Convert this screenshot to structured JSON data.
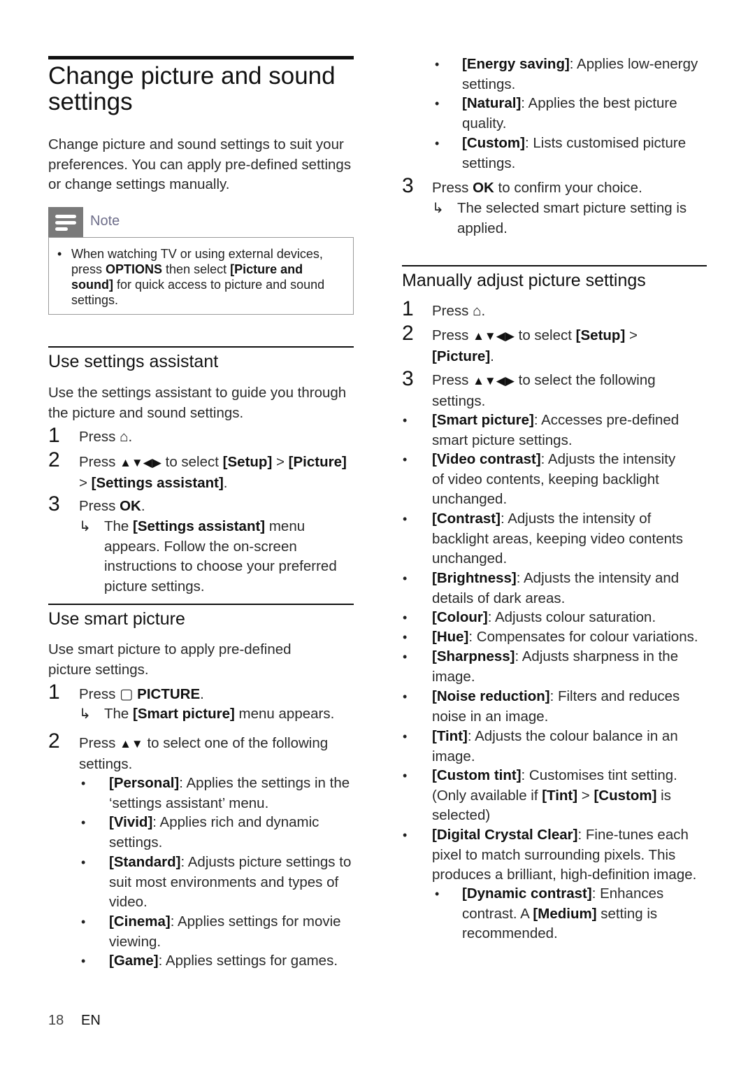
{
  "page": {
    "title": "Change picture and sound settings",
    "intro": "Change picture and sound settings to suit your preferences. You can apply pre-defined settings or change settings manually.",
    "footer": {
      "page_number": "18",
      "language": "EN"
    }
  },
  "note": {
    "label": "Note",
    "icon": "note-lines-icon",
    "text_parts": [
      "When watching TV or using external devices, press ",
      "OPTIONS",
      " then select ",
      "[Picture and sound]",
      " for quick access to picture and sound settings."
    ]
  },
  "settings_assistant": {
    "heading": "Use settings assistant",
    "intro": "Use the settings assistant to guide you through the picture and sound settings.",
    "steps": [
      {
        "num": "1",
        "parts": [
          "Press ",
          "⌂",
          "."
        ]
      },
      {
        "num": "2",
        "parts": [
          "Press ",
          "▲▼◀▶",
          " to select ",
          "[Setup]",
          " > ",
          "[Picture]",
          " > ",
          "[Settings assistant]",
          "."
        ]
      },
      {
        "num": "3",
        "parts": [
          "Press ",
          "OK",
          "."
        ]
      }
    ],
    "result": [
      "The ",
      "[Settings assistant]",
      " menu appears. Follow the on-screen instructions to choose your preferred picture settings."
    ]
  },
  "smart_picture": {
    "heading": "Use smart picture",
    "intro": "Use smart picture to apply pre-defined picture settings.",
    "step1": {
      "num": "1",
      "parts": [
        "Press ",
        "▢",
        " PICTURE",
        "."
      ]
    },
    "step1_result": [
      "The ",
      "[Smart picture]",
      " menu appears."
    ],
    "step2": {
      "num": "2",
      "parts": [
        "Press ",
        "▲▼",
        " to select one of the following settings."
      ]
    },
    "options": [
      {
        "name": "[Personal]",
        "desc": ": Applies the settings in the ‘settings assistant’ menu."
      },
      {
        "name": "[Vivid]",
        "desc": ": Applies rich and dynamic settings."
      },
      {
        "name": "[Standard]",
        "desc": ": Adjusts picture settings to suit most environments and types of video."
      },
      {
        "name": "[Cinema]",
        "desc": ": Applies settings for movie viewing."
      },
      {
        "name": "[Game]",
        "desc": ": Applies settings for games."
      },
      {
        "name": "[Energy saving]",
        "desc": ": Applies low-energy settings."
      },
      {
        "name": "[Natural]",
        "desc": ": Applies the best picture quality."
      },
      {
        "name": "[Custom]",
        "desc": ": Lists customised picture settings."
      }
    ],
    "step3": {
      "num": "3",
      "parts": [
        "Press ",
        "OK",
        " to confirm your choice."
      ]
    },
    "step3_result": "The selected smart picture setting is applied."
  },
  "manual": {
    "heading": "Manually adjust picture settings",
    "steps": [
      {
        "num": "1",
        "parts": [
          "Press ",
          "⌂",
          "."
        ]
      },
      {
        "num": "2",
        "parts": [
          "Press ",
          "▲▼◀▶",
          " to select ",
          "[Setup]",
          " > ",
          "[Picture]",
          "."
        ]
      },
      {
        "num": "3",
        "parts": [
          "Press ",
          "▲▼◀▶",
          " to select the following settings."
        ]
      }
    ],
    "options": [
      {
        "name": "[Smart picture]",
        "desc": ": Accesses pre-defined smart picture settings."
      },
      {
        "name": "[Video contrast]",
        "desc": ": Adjusts the intensity of video contents, keeping backlight unchanged."
      },
      {
        "name": "[Contrast]",
        "desc": ": Adjusts the intensity of backlight areas, keeping video contents unchanged."
      },
      {
        "name": "[Brightness]",
        "desc": ": Adjusts the intensity and details of dark areas."
      },
      {
        "name": "[Colour]",
        "desc": ": Adjusts colour saturation."
      },
      {
        "name": "[Hue]",
        "desc": ": Compensates for colour variations."
      },
      {
        "name": "[Sharpness]",
        "desc": ": Adjusts sharpness in the image."
      },
      {
        "name": "[Noise reduction]",
        "desc": ": Filters and reduces noise in an image."
      },
      {
        "name": "[Tint]",
        "desc": ": Adjusts the colour balance in an image."
      },
      {
        "name": "[Custom tint]",
        "desc": ": Customises tint setting. (Only available if ",
        "name2": "[Tint]",
        "mid": " > ",
        "name3": "[Custom]",
        "tail": " is selected)"
      },
      {
        "name": "[Digital Crystal Clear]",
        "desc": ": Fine-tunes each pixel to match surrounding pixels. This produces a brilliant, high-definition image."
      }
    ],
    "sub_option": {
      "name": "[Dynamic contrast]",
      "desc": ": Enhances contrast. A ",
      "name2": "[Medium]",
      "tail": " setting is recommended."
    }
  }
}
